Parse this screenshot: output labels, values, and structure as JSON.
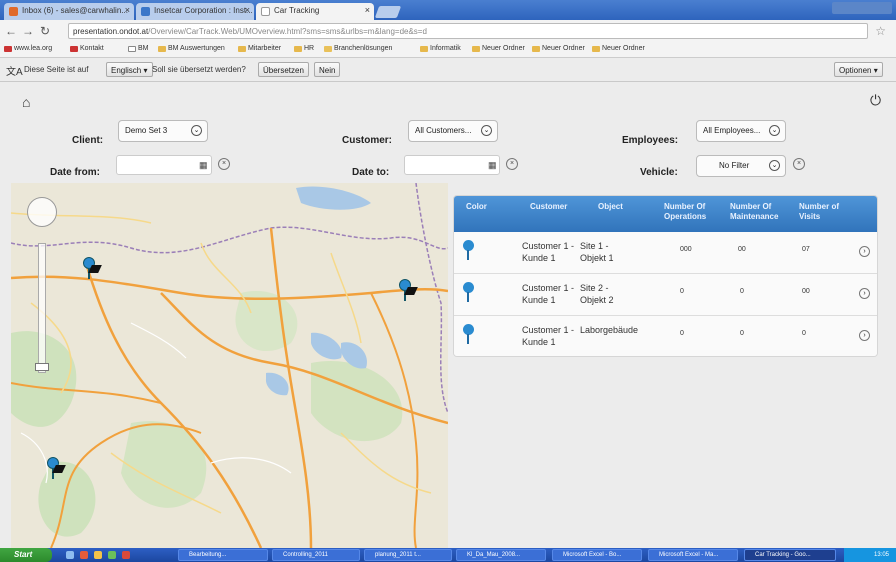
{
  "browser": {
    "tabs": [
      {
        "label": "Inbox (6) - sales@carwhalin..."
      },
      {
        "label": "Insetcar Corporation : Inst..."
      },
      {
        "label": "Car Tracking",
        "active": true
      }
    ],
    "url": "presentation.ondot.at",
    "url_rest": "/Overview/CarTrack.Web/UMOverview.html?sms=sms&urlbs=m&lang=de&s=d",
    "bookmarks": [
      "www.lea.org",
      "Kontakt",
      "BM",
      "BM Auswertungen",
      "Mitarbeiter",
      "HR",
      "Branchenlösungen",
      "Informatik",
      "Neuer Ordner",
      "Neuer Ordner",
      "Neuer Ordner"
    ]
  },
  "translate_bar": {
    "prefix": "Diese Seite ist auf",
    "language": "Englisch",
    "question": "Soll sie übersetzt werden?",
    "translate_label": "Übersetzen",
    "no_label": "Nein",
    "options_label": "Optionen"
  },
  "filters": {
    "client_label": "Client:",
    "client_value": "Demo Set 3",
    "customer_label": "Customer:",
    "customer_value": "All Customers...",
    "employees_label": "Employees:",
    "employees_value": "All Employees...",
    "date_from_label": "Date from:",
    "date_from_value": "",
    "date_to_label": "Date to:",
    "date_to_value": "",
    "vehicle_label": "Vehicle:",
    "vehicle_value": "No Filter"
  },
  "table": {
    "headers": [
      "Color",
      "Customer",
      "Object",
      "Number Of Operations",
      "Number Of Maintenance",
      "Number of Visits"
    ],
    "rows": [
      {
        "customer": "Customer 1 - Kunde 1",
        "object": "Site 1 - Objekt 1",
        "operations": "000",
        "maintenance": "00",
        "visits": "07",
        "color": "#2a8bd0"
      },
      {
        "customer": "Customer 1 - Kunde 1",
        "object": "Site 2 - Objekt 2",
        "operations": "0",
        "maintenance": "0",
        "visits": "00",
        "color": "#2a8bd0"
      },
      {
        "customer": "Customer 1 - Kunde 1",
        "object": "Laborgebäude",
        "operations": "0",
        "maintenance": "0",
        "visits": "0",
        "color": "#2a8bd0"
      }
    ]
  },
  "taskbar": {
    "start_label": "Start",
    "items": [
      "Bearbeitung...",
      "Controlling_2011",
      "planung_2011 t...",
      "Kl_Da_Mau_2008...",
      "Microsoft Excel - Bo...",
      "Microsoft Excel - Ma...",
      "Car Tracking - Goo..."
    ],
    "clock": "13:05"
  }
}
